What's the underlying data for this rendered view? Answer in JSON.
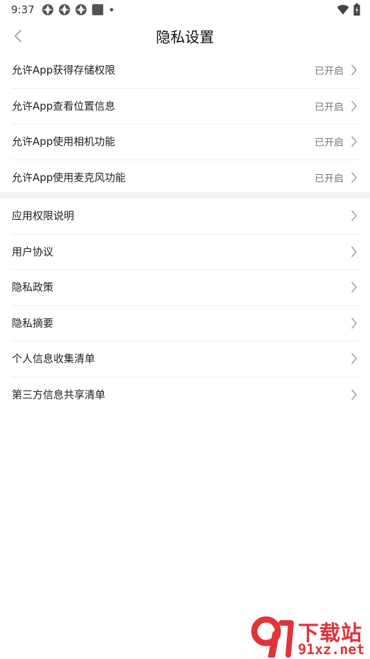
{
  "status_bar": {
    "time": "9:37",
    "notification_icons": [
      "app-notification-icon",
      "app-notification-icon",
      "app-notification-icon",
      "square-notification-icon",
      "dot-icon"
    ],
    "right_icons": [
      "wifi-icon",
      "battery-icon"
    ]
  },
  "header": {
    "title": "隐私设置",
    "back_icon": "chevron-left-icon"
  },
  "permissions": [
    {
      "label": "允许App获得存储权限",
      "status": "已开启"
    },
    {
      "label": "允许App查看位置信息",
      "status": "已开启"
    },
    {
      "label": "允许App使用相机功能",
      "status": "已开启"
    },
    {
      "label": "允许App使用麦克风功能",
      "status": "已开启"
    }
  ],
  "links": [
    {
      "label": "应用权限说明"
    },
    {
      "label": "用户协议"
    },
    {
      "label": "隐私政策"
    },
    {
      "label": "隐私摘要"
    },
    {
      "label": "个人信息收集清单"
    },
    {
      "label": "第三方信息共享清单"
    }
  ],
  "watermark": {
    "title": "下载站",
    "domain": "91xz.net",
    "color": "#e0333a"
  }
}
